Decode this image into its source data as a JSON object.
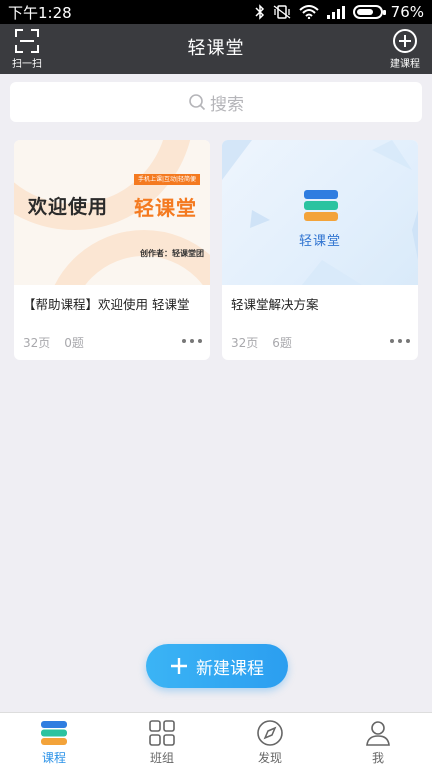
{
  "status_bar": {
    "time": "下午1:28",
    "battery": "76%",
    "battery_level": 0.76
  },
  "header": {
    "title": "轻课堂",
    "scan_label": "扫一扫",
    "scan_icon": "scan-icon",
    "create_label": "建课程",
    "create_icon": "plus-circle-icon"
  },
  "search": {
    "placeholder": "搜索",
    "icon": "search-icon"
  },
  "courses": [
    {
      "title": "【帮助课程】欢迎使用 轻课堂",
      "pages": "32页",
      "questions": "0题",
      "thumb": {
        "welcome": "欢迎使用",
        "tag": "手机上课|互动|轻简便",
        "brand": "轻课堂",
        "author": "创作者：轻课堂团"
      }
    },
    {
      "title": "轻课堂解决方案",
      "pages": "32页",
      "questions": "6题",
      "thumb": {
        "name": "轻课堂"
      }
    }
  ],
  "fab": {
    "label": "新建课程",
    "icon": "plus-icon"
  },
  "bottom_nav": {
    "items": [
      {
        "label": "课程",
        "icon": "course-icon",
        "active": true
      },
      {
        "label": "班组",
        "icon": "grid-icon",
        "active": false
      },
      {
        "label": "发现",
        "icon": "compass-icon",
        "active": false
      },
      {
        "label": "我",
        "icon": "user-icon",
        "active": false
      }
    ]
  },
  "colors": {
    "accent": "#2a92e8",
    "header_bg": "#3a3b3f",
    "page_bg": "#efeef3",
    "brand_orange": "#f47a20"
  }
}
